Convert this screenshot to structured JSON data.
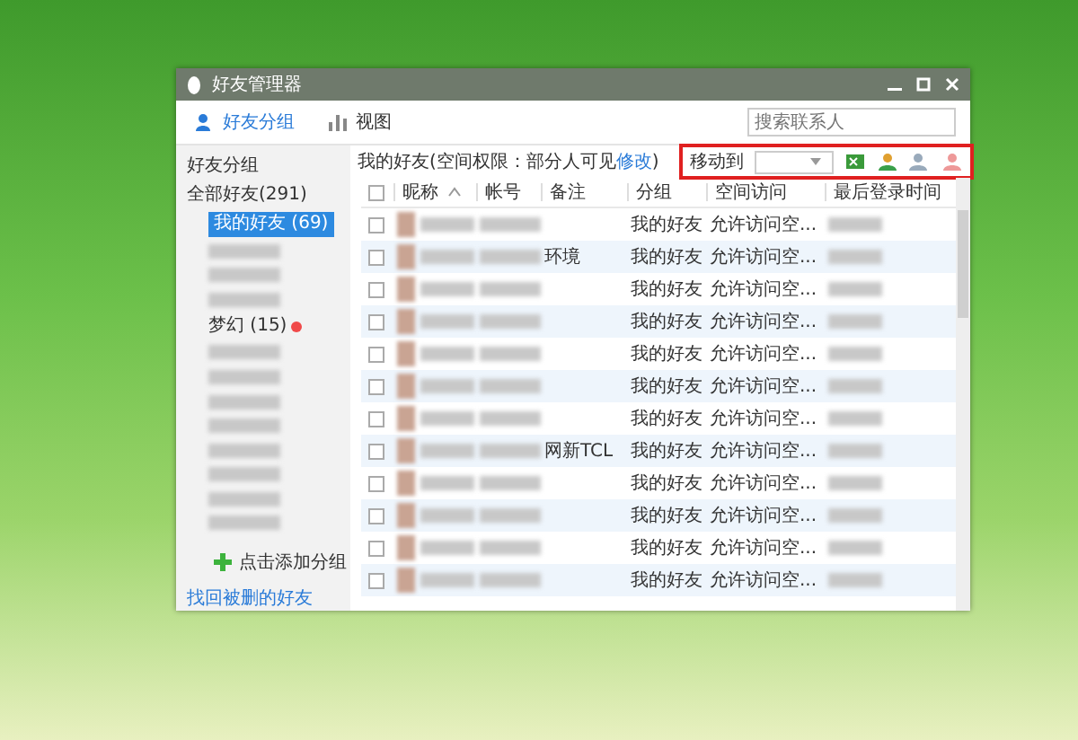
{
  "window": {
    "title": "好友管理器"
  },
  "tabs": [
    {
      "label": "好友分组",
      "selected": true
    },
    {
      "label": "视图",
      "selected": false
    }
  ],
  "search": {
    "placeholder": "搜索联系人"
  },
  "sidebar": {
    "heading": "好友分组",
    "items": [
      {
        "kind": "group",
        "label": "全部好友(291)",
        "selected": false,
        "children": [
          {
            "kind": "group",
            "label": "我的好友 (69)",
            "selected": true,
            "badge": false
          },
          {
            "kind": "blurred"
          },
          {
            "kind": "blurred"
          },
          {
            "kind": "blurred"
          },
          {
            "kind": "group",
            "label": "梦幻 (15)",
            "selected": false,
            "badge": true
          },
          {
            "kind": "blurred"
          },
          {
            "kind": "blurred"
          },
          {
            "kind": "blurred"
          },
          {
            "kind": "blurred"
          },
          {
            "kind": "blurred"
          },
          {
            "kind": "blurred"
          },
          {
            "kind": "blurred"
          },
          {
            "kind": "blurred"
          }
        ]
      }
    ],
    "add_group": "点击添加分组",
    "recover_link": "找回被删的好友"
  },
  "info": {
    "text": "我的好友(空间权限：部分人可见",
    "link": "修改",
    "tail": ")"
  },
  "toolbar": {
    "highlighted": true,
    "move_label": "移动到"
  },
  "table": {
    "all_checked": false,
    "columns": [
      {
        "label": "昵称",
        "sorted": true
      },
      {
        "label": "帐号"
      },
      {
        "label": "备注"
      },
      {
        "label": "分组"
      },
      {
        "label": "空间访问"
      },
      {
        "label": "最后登录时间"
      }
    ],
    "rows": [
      {
        "checked": false,
        "group": "我的好友",
        "access": "允许访问空..."
      },
      {
        "checked": false,
        "remark": "环境",
        "group": "我的好友",
        "access": "允许访问空..."
      },
      {
        "checked": false,
        "group": "我的好友",
        "access": "允许访问空..."
      },
      {
        "checked": false,
        "group": "我的好友",
        "access": "允许访问空..."
      },
      {
        "checked": false,
        "group": "我的好友",
        "access": "允许访问空..."
      },
      {
        "checked": false,
        "group": "我的好友",
        "access": "允许访问空..."
      },
      {
        "checked": false,
        "group": "我的好友",
        "access": "允许访问空..."
      },
      {
        "checked": false,
        "remark": "网新TCL",
        "group": "我的好友",
        "access": "允许访问空..."
      },
      {
        "checked": false,
        "group": "我的好友",
        "access": "允许访问空..."
      },
      {
        "checked": false,
        "group": "我的好友",
        "access": "允许访问空..."
      },
      {
        "checked": false,
        "group": "我的好友",
        "access": "允许访问空..."
      },
      {
        "checked": false,
        "group": "我的好友",
        "access": "允许访问空..."
      }
    ]
  }
}
